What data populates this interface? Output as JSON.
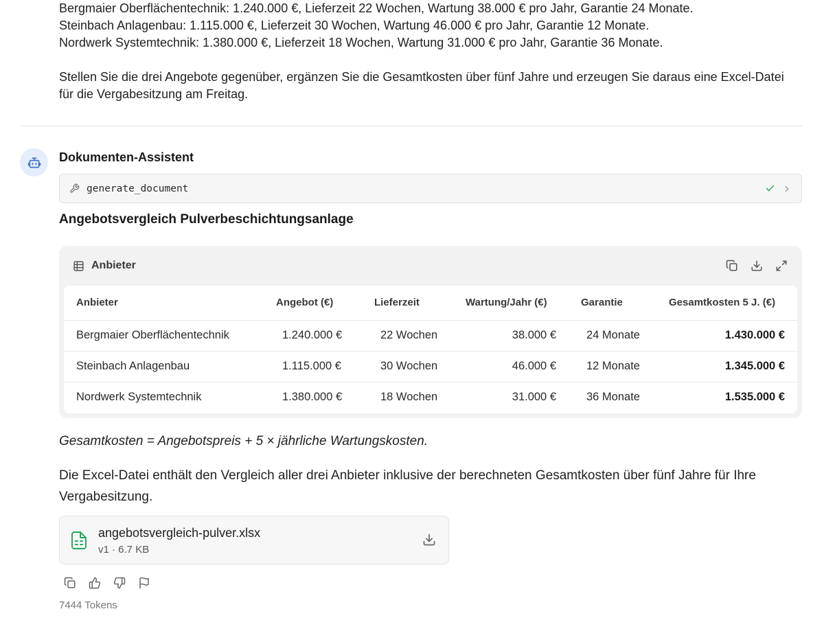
{
  "user_message": {
    "lines": [
      "Bergmaier Oberflächentechnik: 1.240.000 €, Lieferzeit 22 Wochen, Wartung 38.000 € pro Jahr, Garantie 24 Monate.",
      "Steinbach Anlagenbau: 1.115.000 €, Lieferzeit 30 Wochen, Wartung 46.000 € pro Jahr, Garantie 12 Monate.",
      "Nordwerk Systemtechnik: 1.380.000 €, Lieferzeit 18 Wochen, Wartung 31.000 € pro Jahr, Garantie 36 Monate."
    ],
    "request_lines": [
      "Stellen Sie die drei Angebote gegenüber, ergänzen Sie die Gesamtkosten über fünf Jahre und erzeugen Sie daraus eine Excel-Datei",
      "für die Vergabesitzung am Freitag."
    ]
  },
  "assistant": {
    "name": "Dokumenten-Assistent",
    "avatar_icon": "robot-icon",
    "tool_call": {
      "name": "generate_document",
      "status": "success",
      "status_icon": "check-icon",
      "expand_icon": "chevron-right-icon"
    },
    "document_title": "Angebotsvergleich Pulverbeschichtungsanlage",
    "table": {
      "title": "Anbieter",
      "columns": [
        "Anbieter",
        "Angebot (€)",
        "Lieferzeit",
        "Wartung/Jahr (€)",
        "Garantie",
        "Gesamtkosten 5 J. (€)"
      ],
      "rows": [
        [
          "Bergmaier Oberflächentechnik",
          "1.240.000 €",
          "22 Wochen",
          "38.000 €",
          "24 Monate",
          "1.430.000 €"
        ],
        [
          "Steinbach Anlagenbau",
          "1.115.000 €",
          "30 Wochen",
          "46.000 €",
          "12 Monate",
          "1.345.000 €"
        ],
        [
          "Nordwerk Systemtechnik",
          "1.380.000 €",
          "18 Wochen",
          "31.000 €",
          "36 Monate",
          "1.535.000 €"
        ]
      ]
    },
    "formula": "Gesamtkosten = Angebotspreis + 5 × jährliche Wartungskosten.",
    "summary": "Die Excel-Datei enthält den Vergleich aller drei Anbieter inklusive der berechneten Gesamtkosten über fünf Jahre für Ihre Vergabesitzung.",
    "file": {
      "name": "angebotsvergleich-pulver.xlsx",
      "meta": "v1 · 6.7 KB"
    },
    "tokens": "7444 Tokens"
  },
  "colors": {
    "avatar_bg": "#e4edf9",
    "avatar_fg": "#3b6fc4",
    "success": "#2fa84f",
    "sheet_icon": "#22a559"
  }
}
